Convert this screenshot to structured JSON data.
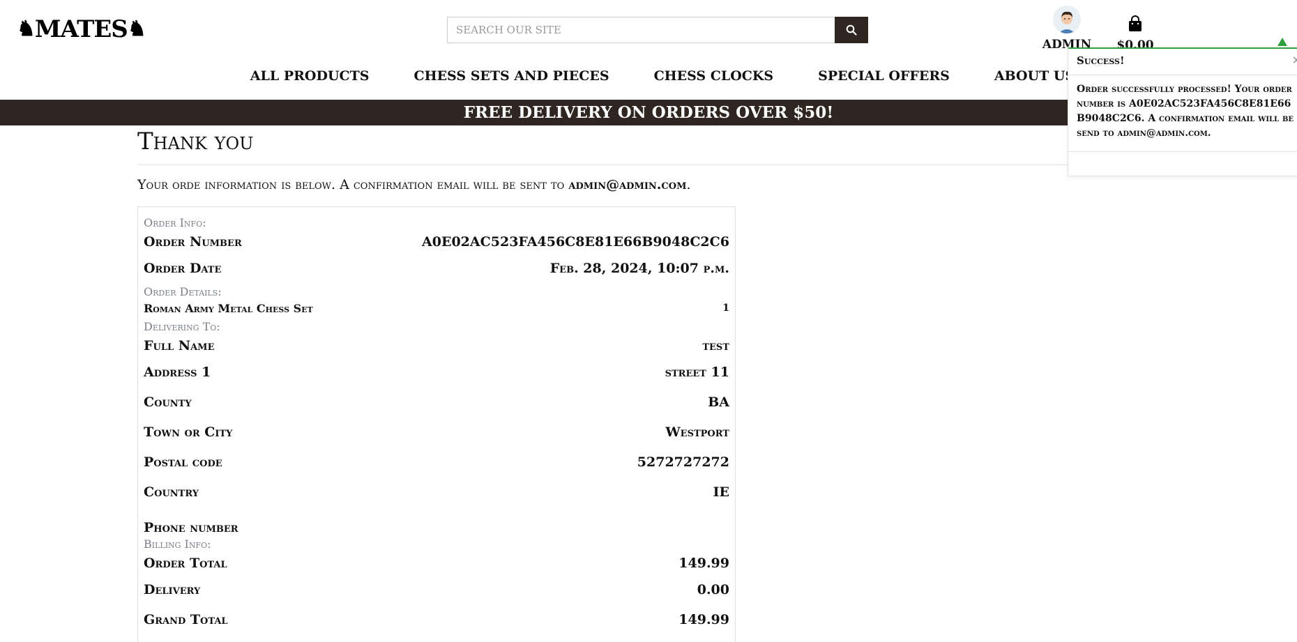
{
  "header": {
    "logo_text": "MATES",
    "search_placeholder": "SEARCH OUR SITE",
    "account_label": "ADMIN",
    "bag_total": "$0.00"
  },
  "nav": {
    "items": [
      "ALL PRODUCTS",
      "CHESS SETS AND PIECES",
      "CHESS CLOCKS",
      "SPECIAL OFFERS",
      "ABOUT US"
    ]
  },
  "banner": {
    "text": "FREE DELIVERY ON ORDERS OVER $50!"
  },
  "page": {
    "title": "Thank you",
    "intro": "Your orde information is below. A confirmation email will be sent to",
    "email": "admin@admin.com",
    "intro_end": "."
  },
  "order": {
    "info_label": "Order Info:",
    "number_label": "Order Number",
    "number_value": "A0E02AC523FA456C8E81E66B9048C2C6",
    "date_label": "Order Date",
    "date_value": "Feb. 28, 2024, 10:07 p.m.",
    "details_label": "Order Details:",
    "item_name": "Roman Army Metal Chess Set",
    "item_qty": "1",
    "delivering_label": "Delivering To:",
    "full_name_label": "Full Name",
    "full_name_value": "test",
    "address1_label": "Address 1",
    "address1_value": "street 11",
    "county_label": "County",
    "county_value": "BA",
    "town_label": "Town or City",
    "town_value": "Westport",
    "postal_label": "Postal code",
    "postal_value": "5272727272",
    "country_label": "Country",
    "country_value": "IE",
    "phone_label": "Phone number",
    "phone_value": "",
    "billing_label": "Billing Info:",
    "order_total_label": "Order Total",
    "order_total_value": "149.99",
    "delivery_label": "Delivery",
    "delivery_value": "0.00",
    "grand_total_label": "Grand Total",
    "grand_total_value": "149.99"
  },
  "toast": {
    "title": "Success!",
    "close": "×",
    "message": "Order successfully processed! Your order number is A0E02AC523FA456C8E81E66B9048C2C6. A confirmation email will be send to admin@admin.com."
  },
  "colors": {
    "banner_bg": "#2f2622",
    "toast_accent": "#2e9e3f"
  }
}
